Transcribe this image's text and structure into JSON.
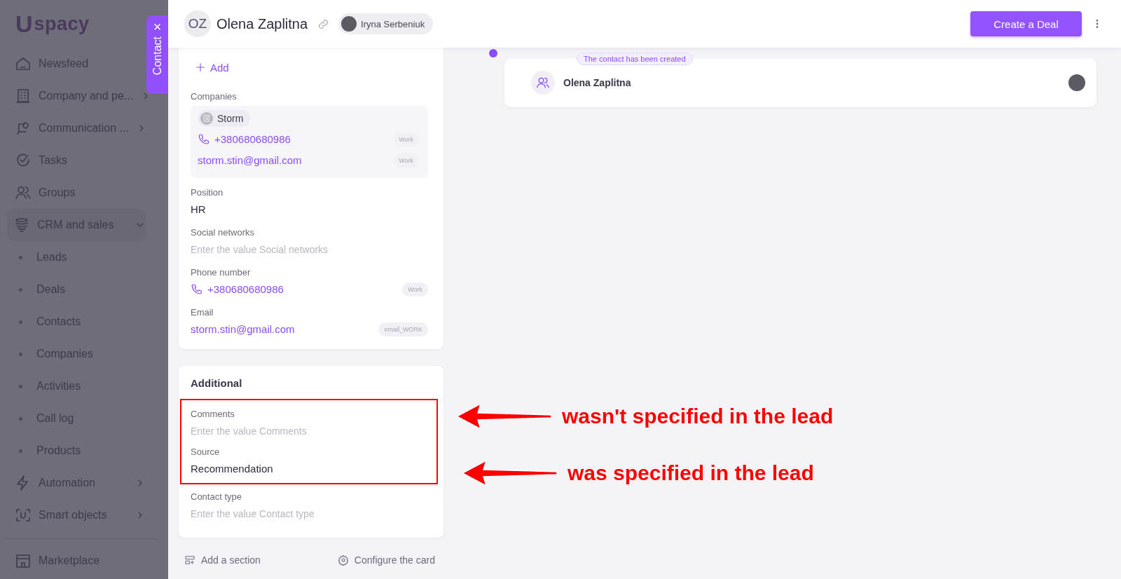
{
  "sidebar": {
    "logo": {
      "mark": "U",
      "word": "spacy"
    },
    "items": [
      {
        "label": "Newsfeed",
        "kind": "link"
      },
      {
        "label": "Company and pe...",
        "kind": "menu",
        "expanded": false
      },
      {
        "label": "Communication ...",
        "kind": "menu",
        "expanded": false
      },
      {
        "label": "Tasks",
        "kind": "link"
      },
      {
        "label": "Groups",
        "kind": "link"
      },
      {
        "label": "CRM and sales",
        "kind": "menu",
        "expanded": true
      },
      {
        "label": "Leads",
        "kind": "sub"
      },
      {
        "label": "Deals",
        "kind": "sub"
      },
      {
        "label": "Contacts",
        "kind": "sub"
      },
      {
        "label": "Companies",
        "kind": "sub"
      },
      {
        "label": "Activities",
        "kind": "sub"
      },
      {
        "label": "Call log",
        "kind": "sub"
      },
      {
        "label": "Products",
        "kind": "sub"
      },
      {
        "label": "Automation",
        "kind": "menu",
        "expanded": false
      },
      {
        "label": "Smart objects",
        "kind": "menu",
        "expanded": false
      }
    ],
    "bottom_items": [
      {
        "label": "Marketplace",
        "kind": "link"
      }
    ]
  },
  "side_tab": {
    "label": "Contact",
    "close": "×"
  },
  "header": {
    "initials": "OZ",
    "name": "Olena Zaplitna",
    "owner": "Iryna Serbeniuk",
    "primary_button": "Create a Deal"
  },
  "main_card": {
    "add_link": "Add",
    "companies": {
      "label": "Companies",
      "name": "Storm",
      "contacts": [
        {
          "kind": "phone",
          "value": "+380680680986",
          "tag": "Work"
        },
        {
          "kind": "email",
          "value": "storm.stin@gmail.com",
          "tag": "Work"
        }
      ]
    },
    "fields": [
      {
        "label": "Position",
        "kind": "text",
        "value": "HR"
      },
      {
        "label": "Social networks",
        "kind": "empty",
        "placeholder": "Enter the value Social networks"
      },
      {
        "label": "Phone number",
        "kind": "phone",
        "value": "+380680680986",
        "tag": "Work"
      },
      {
        "label": "Email",
        "kind": "email",
        "value": "storm.stin@gmail.com",
        "tag": "email_WORK"
      }
    ]
  },
  "additional": {
    "title": "Additional",
    "fields": [
      {
        "label": "Comments",
        "kind": "empty",
        "placeholder": "Enter the value Comments",
        "marked": true
      },
      {
        "label": "Source",
        "kind": "text",
        "value": "Recommendation",
        "marked": true
      },
      {
        "label": "Contact type",
        "kind": "empty",
        "placeholder": "Enter the value Contact type",
        "marked": false
      }
    ]
  },
  "card_actions": [
    "Add a section",
    "Configure the card"
  ],
  "timeline": {
    "event": {
      "badge": "The contact has been created",
      "title": "Olena Zaplitna"
    }
  },
  "annotations": [
    {
      "text": "wasn't specified in the lead"
    },
    {
      "text": "was specified in the lead"
    }
  ]
}
